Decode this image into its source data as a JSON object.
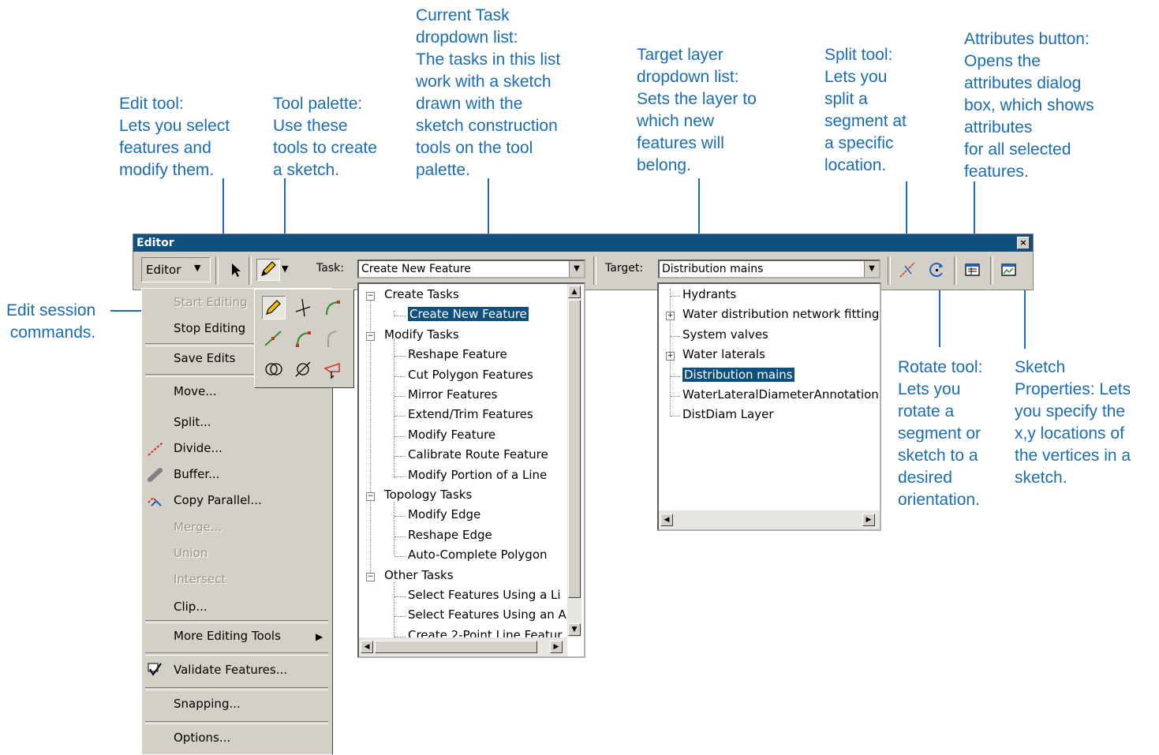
{
  "callouts": {
    "edit_tool": "Edit tool:\nLets you select\nfeatures and\nmodify them.",
    "tool_palette": "Tool palette:\nUse these\ntools to create\na sketch.",
    "current_task": "Current Task\ndropdown list:\nThe tasks in this list\nwork with a sketch\ndrawn with the\nsketch construction\ntools on the tool\npalette.",
    "target_layer": "Target layer\ndropdown list:\nSets the layer to\nwhich new\nfeatures will\nbelong.",
    "split_tool": "Split tool:\nLets you\nsplit a\nsegment at\na specific\nlocation.",
    "attributes_button": "Attributes button:\nOpens the\nattributes dialog\nbox, which shows\nattributes\nfor all selected\nfeatures.",
    "edit_session": "Edit session\ncommands.",
    "rotate_tool": "Rotate tool:\nLets you\nrotate a\nsegment or\nsketch to a\ndesired\norientation.",
    "sketch_properties": "Sketch\nProperties: Lets\nyou specify the\nx,y locations of\nthe vertices in a\nsketch."
  },
  "toolbar": {
    "title": "Editor",
    "close_glyph": "×",
    "editor_menu_label": "Editor",
    "task_label": "Task:",
    "task_value": "Create New Feature",
    "target_label": "Target:",
    "target_value": "Distribution mains"
  },
  "editor_menu": {
    "items": [
      {
        "label": "Start Editing",
        "enabled": false
      },
      {
        "label": "Stop Editing",
        "enabled": true
      },
      {
        "label": "Save Edits",
        "enabled": true
      },
      {
        "label": "Move...",
        "enabled": true
      },
      {
        "label": "Split...",
        "enabled": true
      },
      {
        "label": "Divide...",
        "enabled": true,
        "icon": "divide-icon"
      },
      {
        "label": "Buffer...",
        "enabled": true,
        "icon": "buffer-icon"
      },
      {
        "label": "Copy Parallel...",
        "enabled": true,
        "icon": "copy-parallel-icon"
      },
      {
        "label": "Merge...",
        "enabled": false
      },
      {
        "label": "Union",
        "enabled": false
      },
      {
        "label": "Intersect",
        "enabled": false
      },
      {
        "label": "Clip...",
        "enabled": true
      },
      {
        "label": "More Editing Tools",
        "enabled": true,
        "submenu": true
      },
      {
        "label": "Validate Features...",
        "enabled": true,
        "icon": "validate-icon"
      },
      {
        "label": "Snapping...",
        "enabled": true
      },
      {
        "label": "Options...",
        "enabled": true
      }
    ]
  },
  "task_tree": {
    "nodes": [
      {
        "label": "Create Tasks",
        "level": 0,
        "expander": "−"
      },
      {
        "label": "Create New Feature",
        "level": 1,
        "selected": true
      },
      {
        "label": "Modify Tasks",
        "level": 0,
        "expander": "−"
      },
      {
        "label": "Reshape Feature",
        "level": 1
      },
      {
        "label": "Cut Polygon Features",
        "level": 1
      },
      {
        "label": "Mirror Features",
        "level": 1
      },
      {
        "label": "Extend/Trim Features",
        "level": 1
      },
      {
        "label": "Modify Feature",
        "level": 1
      },
      {
        "label": "Calibrate Route Feature",
        "level": 1
      },
      {
        "label": "Modify Portion of a Line",
        "level": 1
      },
      {
        "label": "Topology Tasks",
        "level": 0,
        "expander": "−"
      },
      {
        "label": "Modify Edge",
        "level": 1
      },
      {
        "label": "Reshape Edge",
        "level": 1
      },
      {
        "label": "Auto-Complete Polygon",
        "level": 1
      },
      {
        "label": "Other Tasks",
        "level": 0,
        "expander": "−"
      },
      {
        "label": "Select Features Using a Li",
        "level": 1
      },
      {
        "label": "Select Features Using an A",
        "level": 1
      },
      {
        "label": "Create 2-Point Line Featur",
        "level": 1
      }
    ]
  },
  "target_tree": {
    "nodes": [
      {
        "label": "Hydrants"
      },
      {
        "label": "Water distribution network fitting",
        "expander": "+"
      },
      {
        "label": "System valves"
      },
      {
        "label": "Water laterals",
        "expander": "+"
      },
      {
        "label": "Distribution mains",
        "selected": true
      },
      {
        "label": "WaterLateralDiameterAnnotation"
      },
      {
        "label": "DistDiam Layer"
      }
    ]
  },
  "colors": {
    "callout": "#1a6cb3",
    "titlebar": "#10507e",
    "face": "#d4d0c8",
    "selection": "#10507e",
    "sketch_green": "#2e8b2e",
    "sketch_red": "#d03018"
  }
}
